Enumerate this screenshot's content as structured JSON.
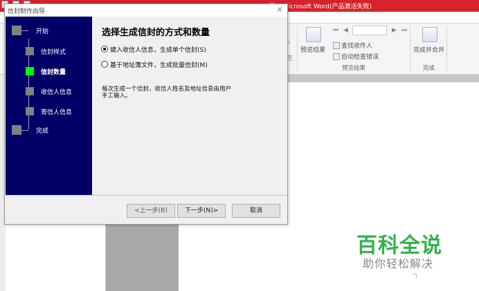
{
  "word": {
    "title": "信封制作向导 - Microsoft Word(产品激活失败)",
    "title_visible": "...图... Microsoft Word(产品激活失败)",
    "ribbon": {
      "preview_results_label": "预览结果",
      "find_recipient_label": "查找收件人",
      "auto_check_label": "自动检查错误",
      "preview_group_label": "预览结果",
      "finish_merge_label": "完成并合并",
      "finish_group_label": "完成",
      "left_partial_label": "签",
      "left_partial_label2": "k",
      "nav_first": "⏮",
      "nav_prev": "◀",
      "nav_next": "▶",
      "nav_last": "⏭"
    }
  },
  "wizard": {
    "title": "信封制作向导",
    "close_glyph": "✕",
    "steps": [
      {
        "label": "开始"
      },
      {
        "label": "信封样式"
      },
      {
        "label": "信封数量"
      },
      {
        "label": "收信人信息"
      },
      {
        "label": "寄信人信息"
      },
      {
        "label": "完成"
      }
    ],
    "active_step": 2,
    "heading": "选择生成信封的方式和数量",
    "options": [
      {
        "label": "键入收信人信息，生成单个信封(S)",
        "checked": true
      },
      {
        "label": "基于地址簿文件，生成批量信封(M)",
        "checked": false
      }
    ],
    "description_line1": "每次生成一个信封，收信人姓名及地址信息由用户",
    "description_line2": "手工输入。",
    "buttons": {
      "back": "<上一步(B)",
      "next": "下一步(N)>",
      "cancel": "取消"
    }
  },
  "watermark": {
    "main": "百科全说",
    "sub": "助你轻松解决"
  },
  "colors": {
    "word_titlebar": "#d6222a",
    "steps_panel": "#000066",
    "active_step": "#00ff00",
    "inactive_step": "#808080",
    "watermark_green": "#2fb34a"
  }
}
